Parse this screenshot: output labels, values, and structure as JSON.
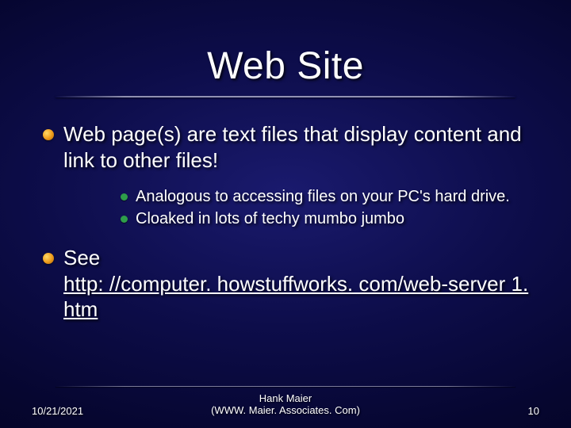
{
  "title": "Web Site",
  "bullets": [
    {
      "text": "Web page(s) are text files that display content and link to other files!",
      "sub": [
        "Analogous to accessing files on your PC's hard drive.",
        "Cloaked in lots of techy mumbo jumbo"
      ]
    }
  ],
  "see": {
    "label": "See",
    "link_text": "http: //computer. howstuffworks. com/web-server 1. htm"
  },
  "footer": {
    "date": "10/21/2021",
    "author_line1": "Hank Maier",
    "author_line2": "(WWW. Maier. Associates. Com)",
    "page": "10"
  }
}
